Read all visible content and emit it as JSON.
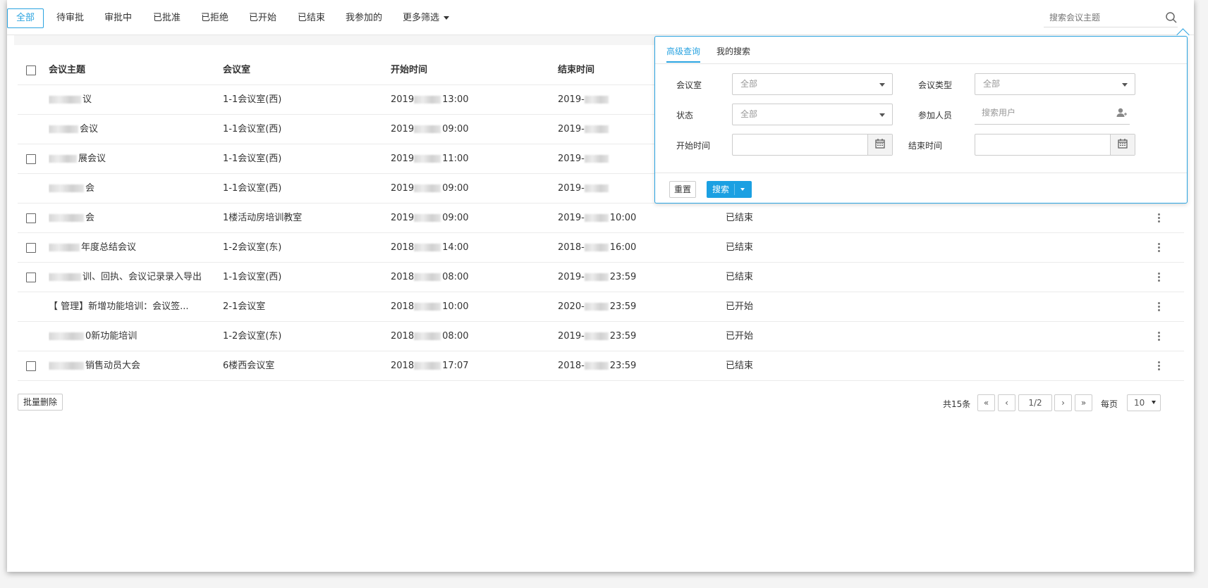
{
  "tabs": [
    {
      "label": "全部",
      "active": true
    },
    {
      "label": "待审批"
    },
    {
      "label": "审批中"
    },
    {
      "label": "已批准"
    },
    {
      "label": "已拒绝"
    },
    {
      "label": "已开始"
    },
    {
      "label": "已结束"
    },
    {
      "label": "我参加的"
    },
    {
      "label": "更多筛选"
    }
  ],
  "search": {
    "placeholder": "搜索会议主题"
  },
  "table": {
    "headers": {
      "subject": "会议主题",
      "room": "会议室",
      "start": "开始时间",
      "end": "结束时间"
    },
    "rows": [
      {
        "subject": "议",
        "room": "1-1会议室(西)",
        "start_a": "2019",
        "start_b": "13:00",
        "end_a": "2019-",
        "end_b": "",
        "status": "",
        "checkbox": false
      },
      {
        "subject": "会议",
        "room": "1-1会议室(西)",
        "start_a": "2019",
        "start_b": "09:00",
        "end_a": "2019-",
        "end_b": "",
        "status": "",
        "checkbox": false
      },
      {
        "subject": "展会议",
        "room": "1-1会议室(西)",
        "start_a": "2019",
        "start_b": "11:00",
        "end_a": "2019-",
        "end_b": "",
        "status": "",
        "checkbox": true
      },
      {
        "subject": "会",
        "room": "1-1会议室(西)",
        "start_a": "2019",
        "start_b": "09:00",
        "end_a": "2019-",
        "end_b": "",
        "status": "",
        "checkbox": false
      },
      {
        "subject": "会",
        "room": "1楼活动房培训教室",
        "start_a": "2019",
        "start_b": "09:00",
        "end_a": "2019-",
        "end_b": "10:00",
        "status": "已结束",
        "checkbox": true
      },
      {
        "subject": "年度总结会议",
        "room": "1-2会议室(东)",
        "start_a": "2018",
        "start_b": "14:00",
        "end_a": "2018-",
        "end_b": "16:00",
        "status": "已结束",
        "checkbox": true
      },
      {
        "subject": "训、回执、会议记录录入导出",
        "room": "1-1会议室(西)",
        "start_a": "2018",
        "start_b": "08:00",
        "end_a": "2019-",
        "end_b": "23:59",
        "status": "已结束",
        "checkbox": true
      },
      {
        "subject": "【 管理】新增功能培训：会议签...",
        "room": "2-1会议室",
        "start_a": "2018",
        "start_b": "10:00",
        "end_a": "2020-",
        "end_b": "23:59",
        "status": "已开始",
        "checkbox": false
      },
      {
        "subject": "0新功能培训",
        "room": "1-2会议室(东)",
        "start_a": "2018",
        "start_b": "08:00",
        "end_a": "2019-",
        "end_b": "23:59",
        "status": "已开始",
        "checkbox": false
      },
      {
        "subject": "销售动员大会",
        "room": "6楼西会议室",
        "start_a": "2018",
        "start_b": "17:07",
        "end_a": "2018-",
        "end_b": "23:59",
        "status": "已结束",
        "checkbox": true
      }
    ]
  },
  "footer": {
    "batch_delete": "批量删除",
    "total": "共15条",
    "first": "«",
    "prev": "‹",
    "page": "1/2",
    "next": "›",
    "last": "»",
    "per_page_label": "每页",
    "per_page_value": "10"
  },
  "panel": {
    "tabs": [
      "高级查询",
      "我的搜索"
    ],
    "room_label": "会议室",
    "room_value": "全部",
    "type_label": "会议类型",
    "type_value": "全部",
    "status_label": "状态",
    "status_value": "全部",
    "participants_label": "参加人员",
    "participants_placeholder": "搜索用户",
    "start_label": "开始时间",
    "end_label": "结束时间",
    "reset": "重置",
    "search": "搜索"
  },
  "colors": {
    "accent": "#2aa3e0",
    "button_primary": "#1ba0e2"
  }
}
